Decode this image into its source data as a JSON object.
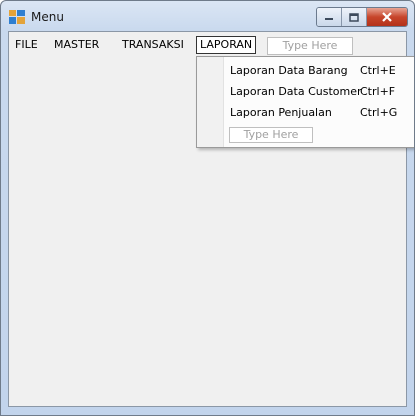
{
  "window": {
    "title": "Menu"
  },
  "menubar": {
    "items": [
      {
        "label": "FILE"
      },
      {
        "label": "MASTER"
      },
      {
        "label": "TRANSAKSI"
      },
      {
        "label": "LAPORAN"
      }
    ],
    "type_here": "Type Here"
  },
  "dropdown": {
    "items": [
      {
        "label": "Laporan Data Barang",
        "shortcut": "Ctrl+E"
      },
      {
        "label": "Laporan Data Customer",
        "shortcut": "Ctrl+F"
      },
      {
        "label": "Laporan Penjualan",
        "shortcut": "Ctrl+G"
      }
    ],
    "type_here": "Type Here"
  },
  "icons": {
    "app": "app-window-icon",
    "minimize": "minimize-icon",
    "maximize": "maximize-icon",
    "close": "close-icon"
  }
}
